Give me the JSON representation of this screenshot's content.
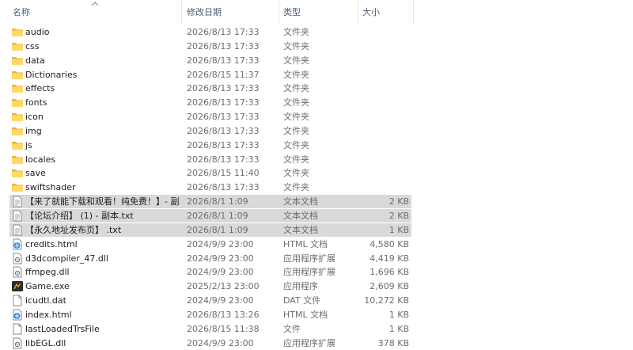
{
  "columns": {
    "name": "名称",
    "date": "修改日期",
    "type": "类型",
    "size": "大小"
  },
  "rows": [
    {
      "name": "audio",
      "date": "2026/8/13 17:33",
      "type": "文件夹",
      "size": "",
      "icon": "folder-icon",
      "selected": false
    },
    {
      "name": "css",
      "date": "2026/8/13 17:33",
      "type": "文件夹",
      "size": "",
      "icon": "folder-icon",
      "selected": false
    },
    {
      "name": "data",
      "date": "2026/8/13 17:33",
      "type": "文件夹",
      "size": "",
      "icon": "folder-icon",
      "selected": false
    },
    {
      "name": "Dictionaries",
      "date": "2026/8/15 11:37",
      "type": "文件夹",
      "size": "",
      "icon": "folder-icon",
      "selected": false
    },
    {
      "name": "effects",
      "date": "2026/8/13 17:33",
      "type": "文件夹",
      "size": "",
      "icon": "folder-icon",
      "selected": false
    },
    {
      "name": "fonts",
      "date": "2026/8/13 17:33",
      "type": "文件夹",
      "size": "",
      "icon": "folder-icon",
      "selected": false
    },
    {
      "name": "icon",
      "date": "2026/8/13 17:33",
      "type": "文件夹",
      "size": "",
      "icon": "folder-icon",
      "selected": false
    },
    {
      "name": "img",
      "date": "2026/8/13 17:33",
      "type": "文件夹",
      "size": "",
      "icon": "folder-icon",
      "selected": false
    },
    {
      "name": "js",
      "date": "2026/8/13 17:33",
      "type": "文件夹",
      "size": "",
      "icon": "folder-icon",
      "selected": false
    },
    {
      "name": "locales",
      "date": "2026/8/13 17:33",
      "type": "文件夹",
      "size": "",
      "icon": "folder-icon",
      "selected": false
    },
    {
      "name": "save",
      "date": "2026/8/15 11:40",
      "type": "文件夹",
      "size": "",
      "icon": "folder-icon",
      "selected": false
    },
    {
      "name": "swiftshader",
      "date": "2026/8/13 17:33",
      "type": "文件夹",
      "size": "",
      "icon": "folder-icon",
      "selected": false
    },
    {
      "name": "【来了就能下载和观看！纯免费！】- 副...",
      "date": "2026/8/1 1:09",
      "type": "文本文档",
      "size": "2 KB",
      "icon": "text-file-icon",
      "selected": true
    },
    {
      "name": "【论坛介绍】 (1) - 副本.txt",
      "date": "2026/8/1 1:09",
      "type": "文本文档",
      "size": "2 KB",
      "icon": "text-file-icon",
      "selected": true
    },
    {
      "name": "【永久地址发布页】 .txt",
      "date": "2026/8/1 1:09",
      "type": "文本文档",
      "size": "1 KB",
      "icon": "text-file-icon",
      "selected": true
    },
    {
      "name": "credits.html",
      "date": "2024/9/9 23:00",
      "type": "HTML 文档",
      "size": "4,580 KB",
      "icon": "html-file-icon",
      "selected": false
    },
    {
      "name": "d3dcompiler_47.dll",
      "date": "2024/9/9 23:00",
      "type": "应用程序扩展",
      "size": "4,419 KB",
      "icon": "dll-file-icon",
      "selected": false
    },
    {
      "name": "ffmpeg.dll",
      "date": "2024/9/9 23:00",
      "type": "应用程序扩展",
      "size": "1,696 KB",
      "icon": "dll-file-icon",
      "selected": false
    },
    {
      "name": "Game.exe",
      "date": "2025/2/13 23:00",
      "type": "应用程序",
      "size": "2,609 KB",
      "icon": "game-exe-icon",
      "selected": false
    },
    {
      "name": "icudtl.dat",
      "date": "2024/9/9 23:00",
      "type": "DAT 文件",
      "size": "10,272 KB",
      "icon": "blank-file-icon",
      "selected": false
    },
    {
      "name": "index.html",
      "date": "2026/8/13 13:26",
      "type": "HTML 文档",
      "size": "1 KB",
      "icon": "html-file-icon",
      "selected": false
    },
    {
      "name": "lastLoadedTrsFile",
      "date": "2026/8/15 11:38",
      "type": "文件",
      "size": "1 KB",
      "icon": "blank-file-icon",
      "selected": false
    },
    {
      "name": "libEGL.dll",
      "date": "2024/9/9 23:00",
      "type": "应用程序扩展",
      "size": "378 KB",
      "icon": "dll-file-icon",
      "selected": false
    }
  ]
}
